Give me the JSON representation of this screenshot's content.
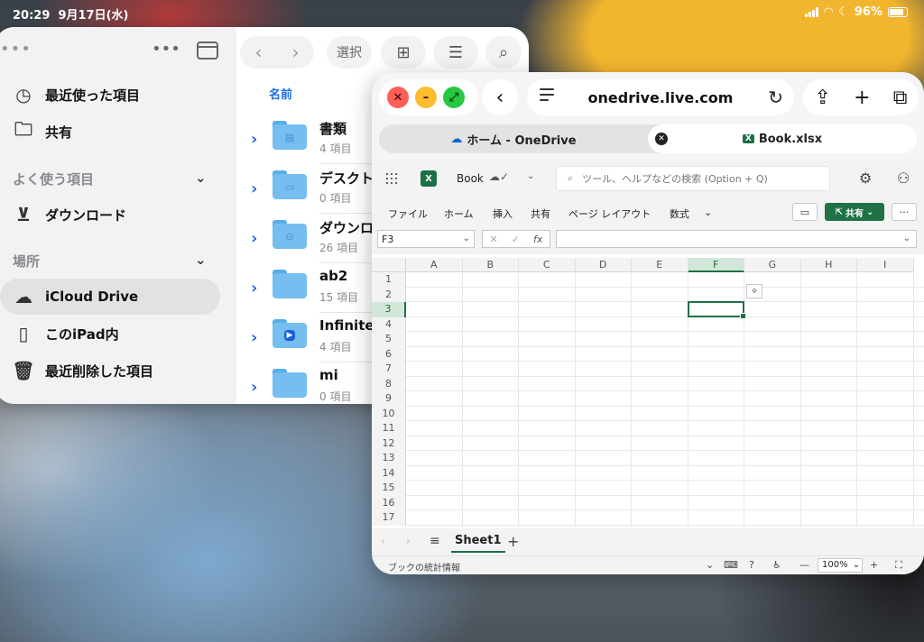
{
  "status": {
    "time": "20:29",
    "date": "9月17日(水)",
    "battery": "96%"
  },
  "files": {
    "sidebar": {
      "recents": "最近使った項目",
      "shared": "共有",
      "favorites_header": "よく使う項目",
      "downloads": "ダウンロード",
      "locations_header": "場所",
      "icloud": "iCloud Drive",
      "on_ipad": "このiPad内",
      "recently_deleted": "最近削除した項目"
    },
    "toolbar": {
      "select": "選択"
    },
    "column_header": "名前",
    "folders": [
      {
        "name": "書類",
        "count": "4 項目"
      },
      {
        "name": "デスクト",
        "count": "0 項目"
      },
      {
        "name": "ダウンロ",
        "count": "26 項目"
      },
      {
        "name": "ab2",
        "count": "15 項目"
      },
      {
        "name": "InfiniteC",
        "count": "4 項目"
      },
      {
        "name": "mi",
        "count": "0 項目"
      }
    ]
  },
  "safari": {
    "url": "onedrive.live.com",
    "tabs": [
      {
        "title": "ホーム - OneDrive"
      },
      {
        "title": "Book.xlsx"
      }
    ]
  },
  "excel": {
    "book_name": "Book",
    "search_placeholder": "ツール、ヘルプなどの検索 (Option + Q)",
    "ribbon_tabs": [
      "ファイル",
      "ホーム",
      "挿入",
      "共有",
      "ページ レイアウト",
      "数式"
    ],
    "share_label": "共有",
    "name_box": "F3",
    "columns": [
      "A",
      "B",
      "C",
      "D",
      "E",
      "F",
      "G",
      "H",
      "I"
    ],
    "rows": [
      "1",
      "2",
      "3",
      "4",
      "5",
      "6",
      "7",
      "8",
      "9",
      "10",
      "11",
      "12",
      "13",
      "14",
      "15",
      "16",
      "17"
    ],
    "selected_cell": {
      "column": "F",
      "row": "3"
    },
    "sheet_name": "Sheet1",
    "status_text": "ブックの統計情報",
    "zoom": "100%",
    "accent": "#1d7044"
  }
}
